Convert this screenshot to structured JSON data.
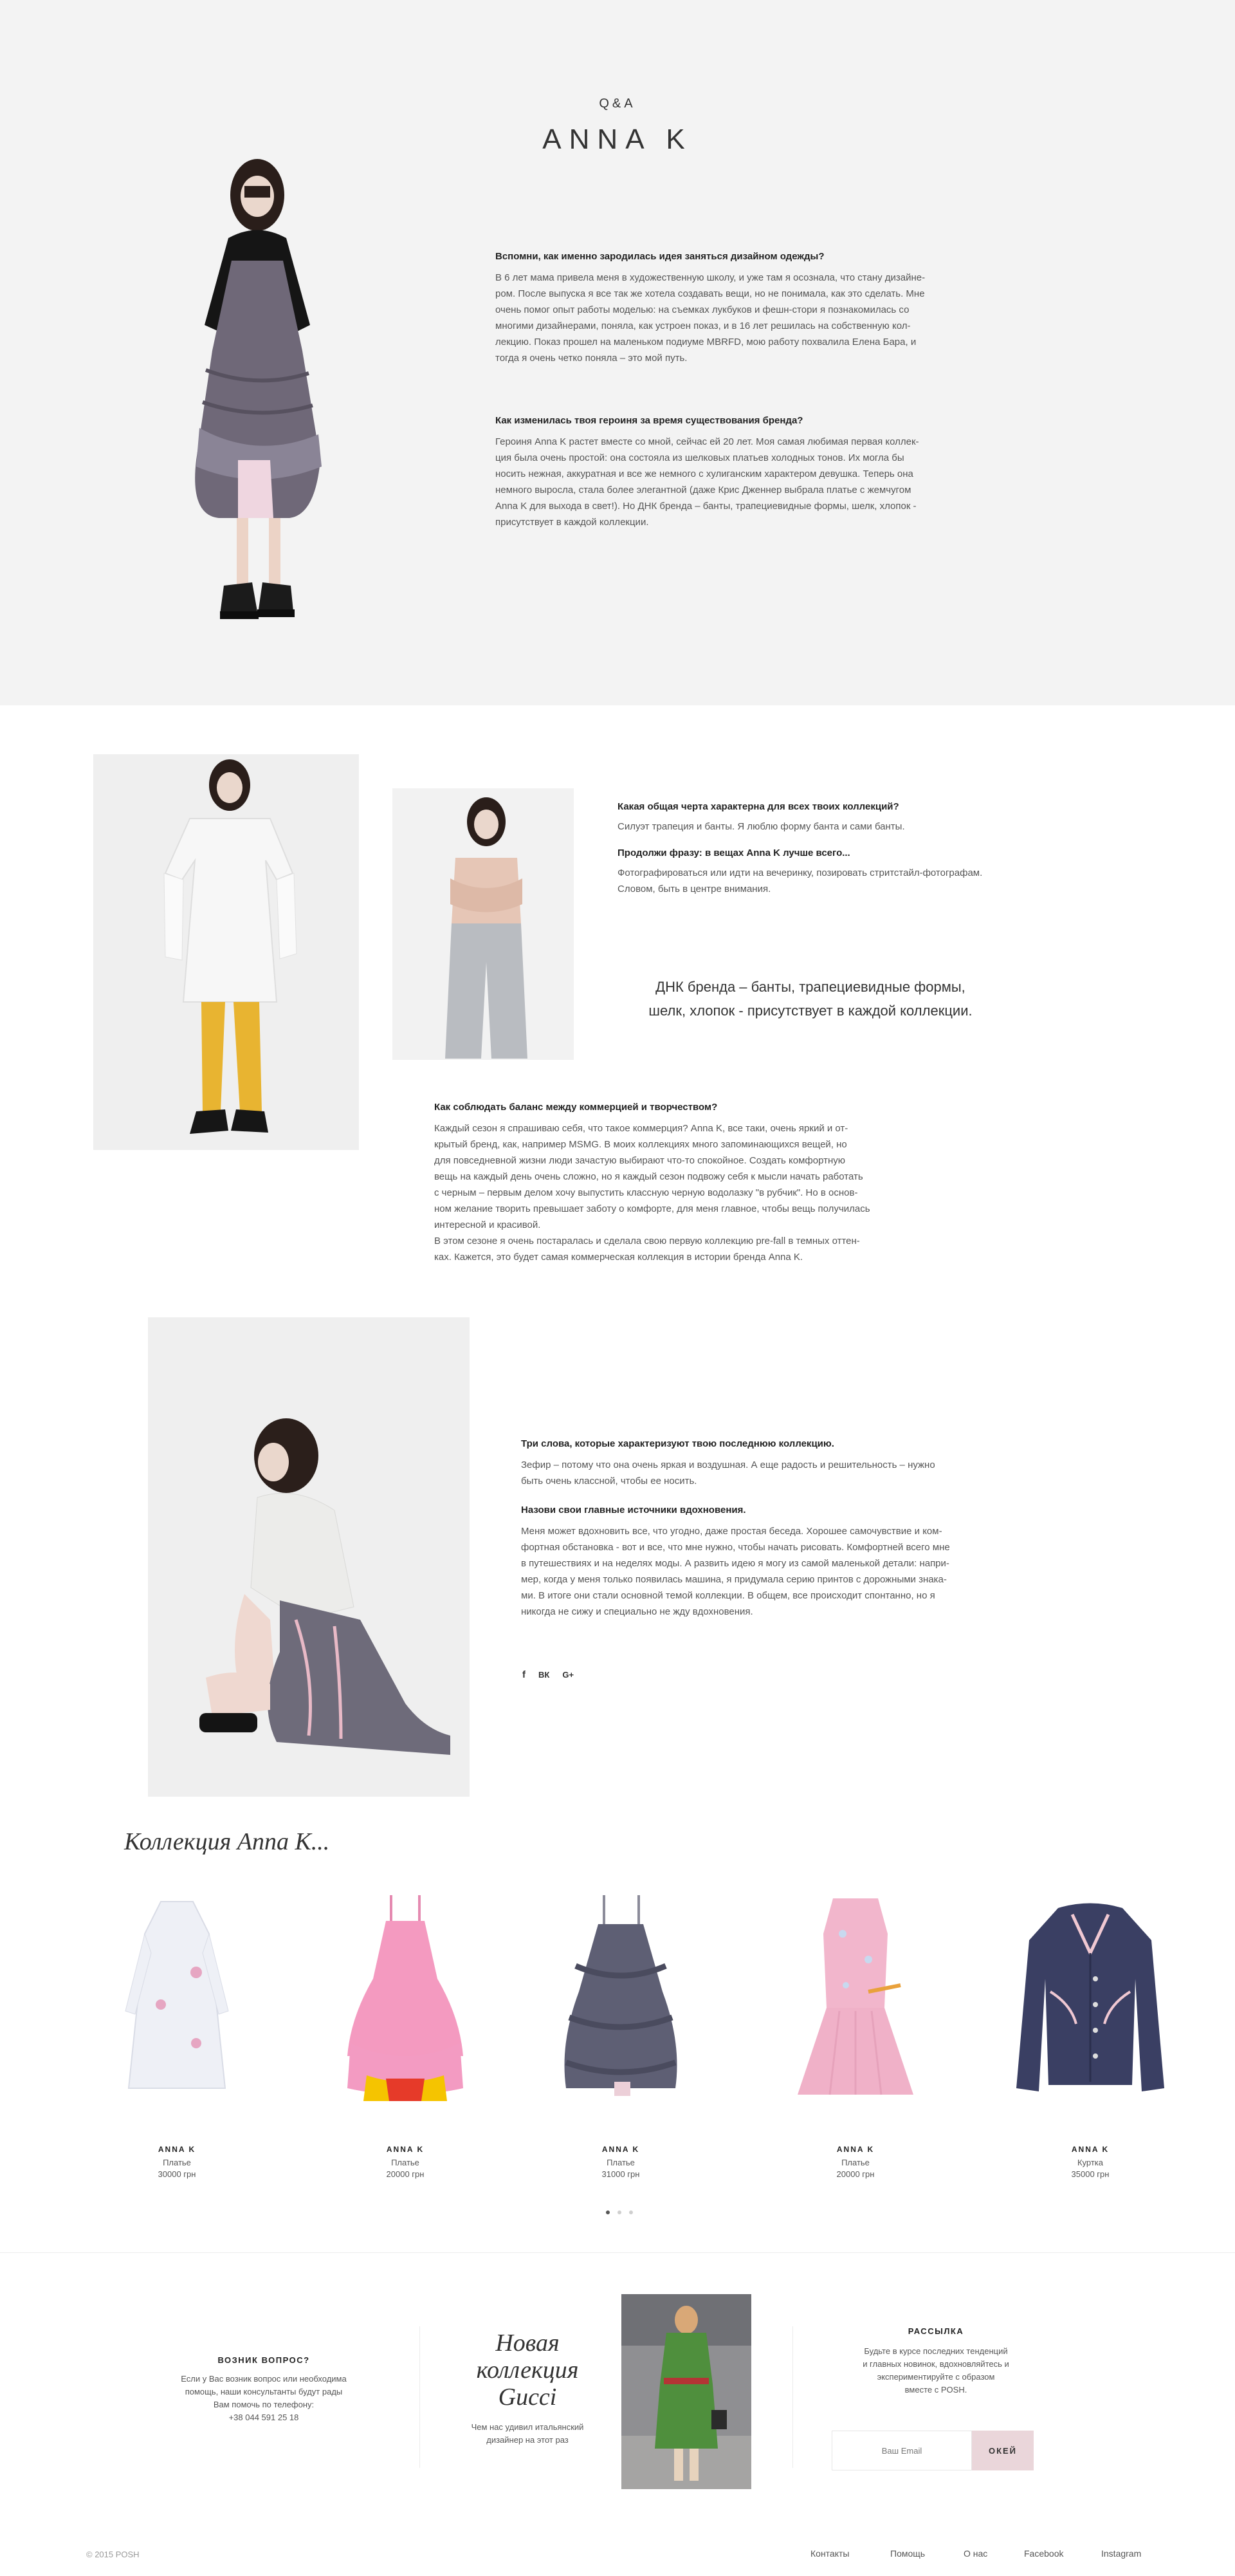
{
  "hero": {
    "kicker": "Q&A",
    "title": "ANNA K",
    "qa": [
      {
        "q": "Вспомни, как именно зародилась идея заняться дизайном одежды?",
        "a": [
          "В 6 лет мама привела меня в художественную школу, и уже там я осознала, что стану дизайне-",
          "ром. После выпуска я все так же хотела создавать вещи, но не понимала, как это сделать. Мне",
          "очень помог опыт работы моделью: на съемках лукбуков и фешн-стори я познакомилась со",
          "многими дизайнерами, поняла, как устроен показ, и в 16 лет решилась на собственную кол-",
          "лекцию. Показ прошел на маленьком подиуме MBRFD, мою работу похвалила Елена Бара, и",
          "тогда я очень четко поняла – это мой путь."
        ]
      },
      {
        "q": "Как изменилась твоя героиня за время существования бренда?",
        "a": [
          "Героиня Anna K растет вместе со мной, сейчас ей 20 лет. Моя самая любимая первая коллек-",
          "ция была очень простой: она состояла из шелковых платьев холодных тонов. Их могла бы",
          "носить нежная, аккуратная и все же немного с хулиганским характером девушка. Теперь она",
          "немного выросла, стала более элегантной (даже Крис Дженнер выбрала платье с жемчугом",
          "Anna K для выхода в свет!). Но ДНК бренда – банты, трапециевидные формы, шелк, хлопок -",
          "присутствует в каждой коллекции."
        ]
      }
    ]
  },
  "section2": {
    "qa": [
      {
        "q": "Какая общая черта характерна для всех твоих коллекций?",
        "a": [
          "Силуэт трапеция и банты. Я люблю форму банта и сами банты."
        ]
      },
      {
        "q": "Продолжи фразу: в вещах Anna K лучше всего...",
        "a": [
          "Фотографироваться или идти на вечеринку, позировать стритстайл-фотографам.",
          "Словом, быть в центре внимания."
        ]
      }
    ],
    "quote": [
      "ДНК бренда – банты, трапециевидные формы,",
      "шелк, хлопок - присутствует в каждой коллекции."
    ],
    "balance": {
      "q": "Как соблюдать баланс между коммерцией и творчеством?",
      "a": [
        "Каждый сезон я спрашиваю себя, что такое коммерция? Anna K, все таки, очень яркий и от-",
        "крытый бренд, как, например MSMG. В моих коллекциях много запоминающихся вещей, но",
        "для повседневной жизни люди зачастую выбирают что-то спокойное. Создать комфортную",
        "вещь на каждый день очень сложно, но я каждый сезон подвожу себя к мысли начать работать",
        "с черным – первым делом хочу выпустить классную черную водолазку \"в рубчик\". Но в основ-",
        "ном желание творить превышает заботу о комфорте, для меня главное, чтобы вещь получилась",
        "интересной и красивой.",
        "В этом сезоне я очень постаралась и сделала свою первую коллекцию pre-fall в темных оттен-",
        "ках. Кажется, это будет самая коммерческая коллекция в истории бренда Anna K."
      ]
    }
  },
  "section3": {
    "qa": [
      {
        "q": "Три слова, которые характеризуют твою последнюю коллекцию.",
        "a": [
          "Зефир – потому что она очень яркая и воздушная. А еще радость и решительность – нужно",
          "быть очень классной, чтобы ее носить."
        ]
      },
      {
        "q": "Назови свои главные источники вдохновения.",
        "a": [
          "Меня может вдохновить все, что угодно, даже простая беседа. Хорошее самочувствие и ком-",
          "фортная обстановка - вот и все, что мне нужно, чтобы начать рисовать. Комфортней всего мне",
          "в путешествиях и на неделях моды. А развить идею я могу из самой маленькой детали: напри-",
          "мер, когда у меня только появилась машина, я придумала серию принтов с дорожными знака-",
          "ми. В итоге они стали основной темой коллекции. В общем, все происходит спонтанно, но я",
          "никогда не сижу и специально не жду вдохновения."
        ]
      }
    ],
    "social": {
      "facebook": "f",
      "vk": "ВК",
      "google": "G+"
    }
  },
  "collection": {
    "title": "Коллекция Anna K...",
    "products": [
      {
        "brand": "ANNA K",
        "type": "Платье",
        "price": "30000 грн",
        "color": "#eef0f6",
        "icon": "white-dress"
      },
      {
        "brand": "ANNA K",
        "type": "Платье",
        "price": "20000 грн",
        "color": "#f49ac0",
        "icon": "pink-ruffle-dress"
      },
      {
        "brand": "ANNA K",
        "type": "Платье",
        "price": "31000 грн",
        "color": "#5e5f74",
        "icon": "grey-ruffle-dress"
      },
      {
        "brand": "ANNA K",
        "type": "Платье",
        "price": "20000 грн",
        "color": "#f2b6cc",
        "icon": "pink-print-dress"
      },
      {
        "brand": "ANNA K",
        "type": "Куртка",
        "price": "35000 грн",
        "color": "#3a3f63",
        "icon": "navy-jacket"
      }
    ],
    "pager": {
      "active": 0,
      "count": 3
    }
  },
  "footer": {
    "question": {
      "title": "ВОЗНИК ВОПРОС?",
      "lines": [
        "Если у Вас возник вопрос или необходима",
        "помощь, наши консультанты будут рады",
        "Вам помочь по телефону:"
      ],
      "phone": "+38 044 591 25 18"
    },
    "promo": {
      "title_lines": [
        "Новая",
        "коллекция",
        "Gucci"
      ],
      "subtitle_lines": [
        "Чем нас удивил итальянский",
        "дизайнер на этот раз"
      ]
    },
    "newsletter": {
      "title": "РАССЫЛКА",
      "lines": [
        "Будьте в курсе последних тенденций",
        "и главных новинок, вдохновляйтесь и",
        "экспериментируйте с образом",
        "вместе с POSH."
      ],
      "placeholder": "Ваш Email",
      "button": "ОКЕЙ"
    },
    "copyright": "© 2015 POSH",
    "nav": [
      "Контакты",
      "Помощь",
      "О нас",
      "Facebook",
      "Instagram"
    ]
  }
}
